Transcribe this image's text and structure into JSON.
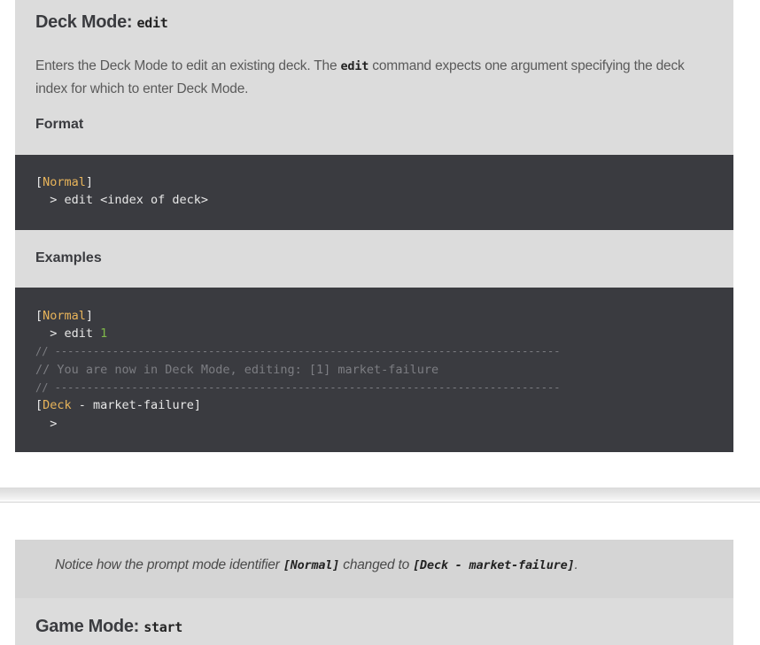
{
  "deck_edit": {
    "title_text": "Deck Mode: ",
    "title_code": "edit",
    "desc_part1": "Enters the Deck Mode to edit an existing deck. The ",
    "desc_code": "edit",
    "desc_part2": " command expects one argument specifying the deck index for which to enter Deck Mode.",
    "format_heading": "Format",
    "format_code": {
      "line1_open": "[",
      "line1_mode": "Normal",
      "line1_close": "]",
      "line2": "  > edit <index of deck>"
    },
    "examples_heading": "Examples",
    "example_code": {
      "line1_open": "[",
      "line1_mode": "Normal",
      "line1_close": "]",
      "line2_cmd": "  > edit ",
      "line2_arg": "1",
      "line3": "// -------------------------------------------------------------------------------",
      "line4": "// You are now in Deck Mode, editing: [1] market-failure",
      "line5": "// -------------------------------------------------------------------------------",
      "line6_open": "[",
      "line6_mode": "Deck",
      "line6_rest": " - market-failure]",
      "line7": "  >"
    }
  },
  "notice": {
    "part1": "Notice how the prompt mode identifier ",
    "code1": "[Normal]",
    "part2": " changed to ",
    "code2": "[Deck - market-failure]",
    "part3": "."
  },
  "game_start": {
    "title_text": "Game Mode: ",
    "title_code": "start"
  },
  "colors": {
    "section_bg": "#dcdcdc",
    "code_bg": "#3a3b40",
    "mode_keyword": "#e8b45a",
    "number": "#7fb84a",
    "comment": "#7c7d82"
  }
}
